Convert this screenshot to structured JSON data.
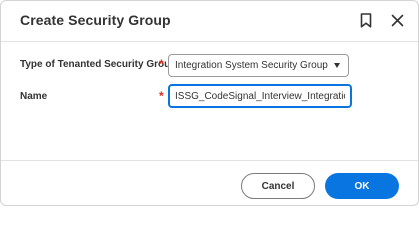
{
  "dialog": {
    "title": "Create Security Group",
    "bookmark_icon": "bookmark-icon",
    "close_icon": "close-icon"
  },
  "form": {
    "type_field": {
      "label": "Type of Tenanted Security Group",
      "required_marker": "*",
      "selected_value": "Integration System Security Group (U..."
    },
    "name_field": {
      "label": "Name",
      "required_marker": "*",
      "value": "ISSG_CodeSignal_Interview_Integration"
    }
  },
  "footer": {
    "cancel_label": "Cancel",
    "ok_label": "OK"
  },
  "colors": {
    "primary": "#0875e1",
    "required": "#de2e21",
    "text": "#333333"
  }
}
